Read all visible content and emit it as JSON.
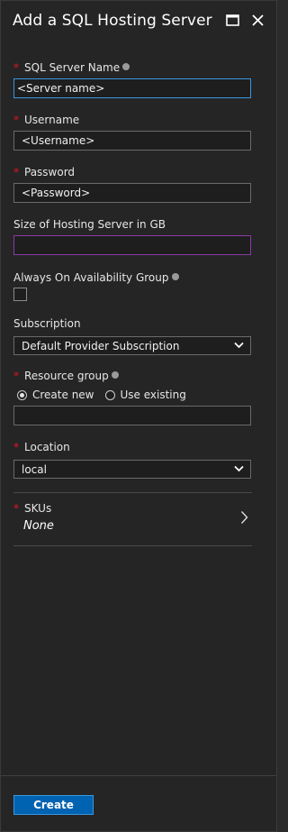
{
  "header": {
    "title": "Add a SQL Hosting Server"
  },
  "fields": {
    "server_name": {
      "label": "SQL Server Name",
      "value": "<Server name>"
    },
    "username": {
      "label": "Username",
      "value": "<Username>"
    },
    "password": {
      "label": "Password",
      "value": "<Password>"
    },
    "size": {
      "label": "Size of Hosting Server in GB",
      "value": ""
    },
    "always_on": {
      "label": "Always On Availability Group"
    },
    "subscription": {
      "label": "Subscription",
      "selected": "Default Provider Subscription"
    },
    "resource_group": {
      "label": "Resource group",
      "option_new": "Create new",
      "option_existing": "Use existing",
      "value": ""
    },
    "location": {
      "label": "Location",
      "selected": "local"
    },
    "skus": {
      "label": "SKUs",
      "value": "None"
    }
  },
  "footer": {
    "create_label": "Create"
  },
  "colors": {
    "background": "#252526",
    "required": "#e81123",
    "focus": "#3a96dd",
    "primary_button": "#0063b1"
  }
}
